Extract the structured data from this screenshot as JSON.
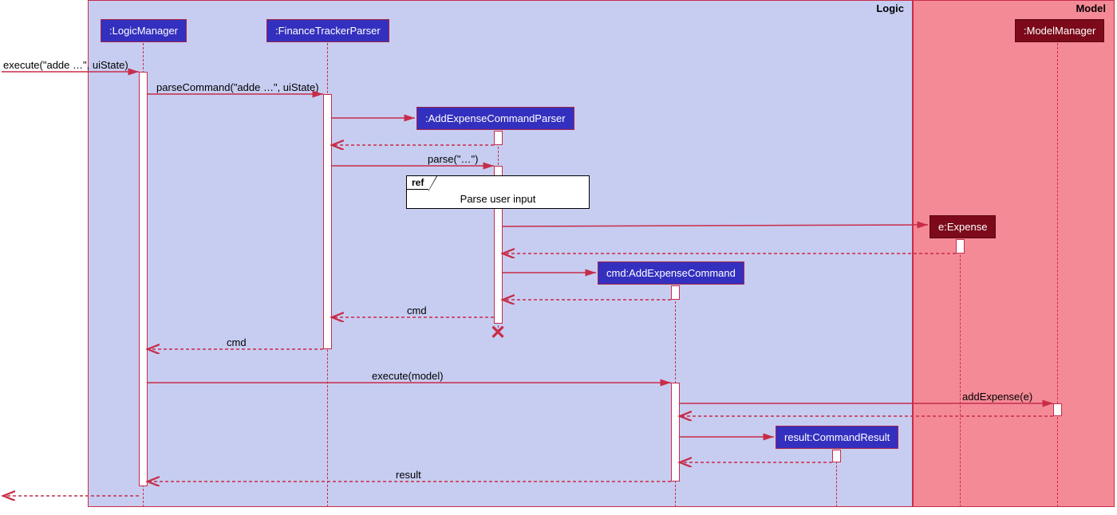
{
  "regions": {
    "logic": {
      "label": "Logic"
    },
    "model": {
      "label": "Model"
    }
  },
  "participants": {
    "logicManager": {
      "label": ":LogicManager"
    },
    "financeTrackerParser": {
      "label": ":FinanceTrackerParser"
    },
    "addExpenseCommandParser": {
      "label": ":AddExpenseCommandParser"
    },
    "addExpenseCommand": {
      "label": "cmd:AddExpenseCommand"
    },
    "commandResult": {
      "label": "result:CommandResult"
    },
    "expense": {
      "label": "e:Expense"
    },
    "modelManager": {
      "label": ":ModelManager"
    }
  },
  "messages": {
    "execute1": "execute(\"adde …\", uiState)",
    "parseCommand": "parseCommand(\"adde …\", uiState)",
    "parse": "parse(\"…\")",
    "cmdReturn1": "cmd",
    "cmdReturn2": "cmd",
    "executeModel": "execute(model)",
    "addExpense": "addExpense(e)",
    "resultReturn": "result"
  },
  "ref": {
    "tag": "ref",
    "text": "Parse user input"
  }
}
